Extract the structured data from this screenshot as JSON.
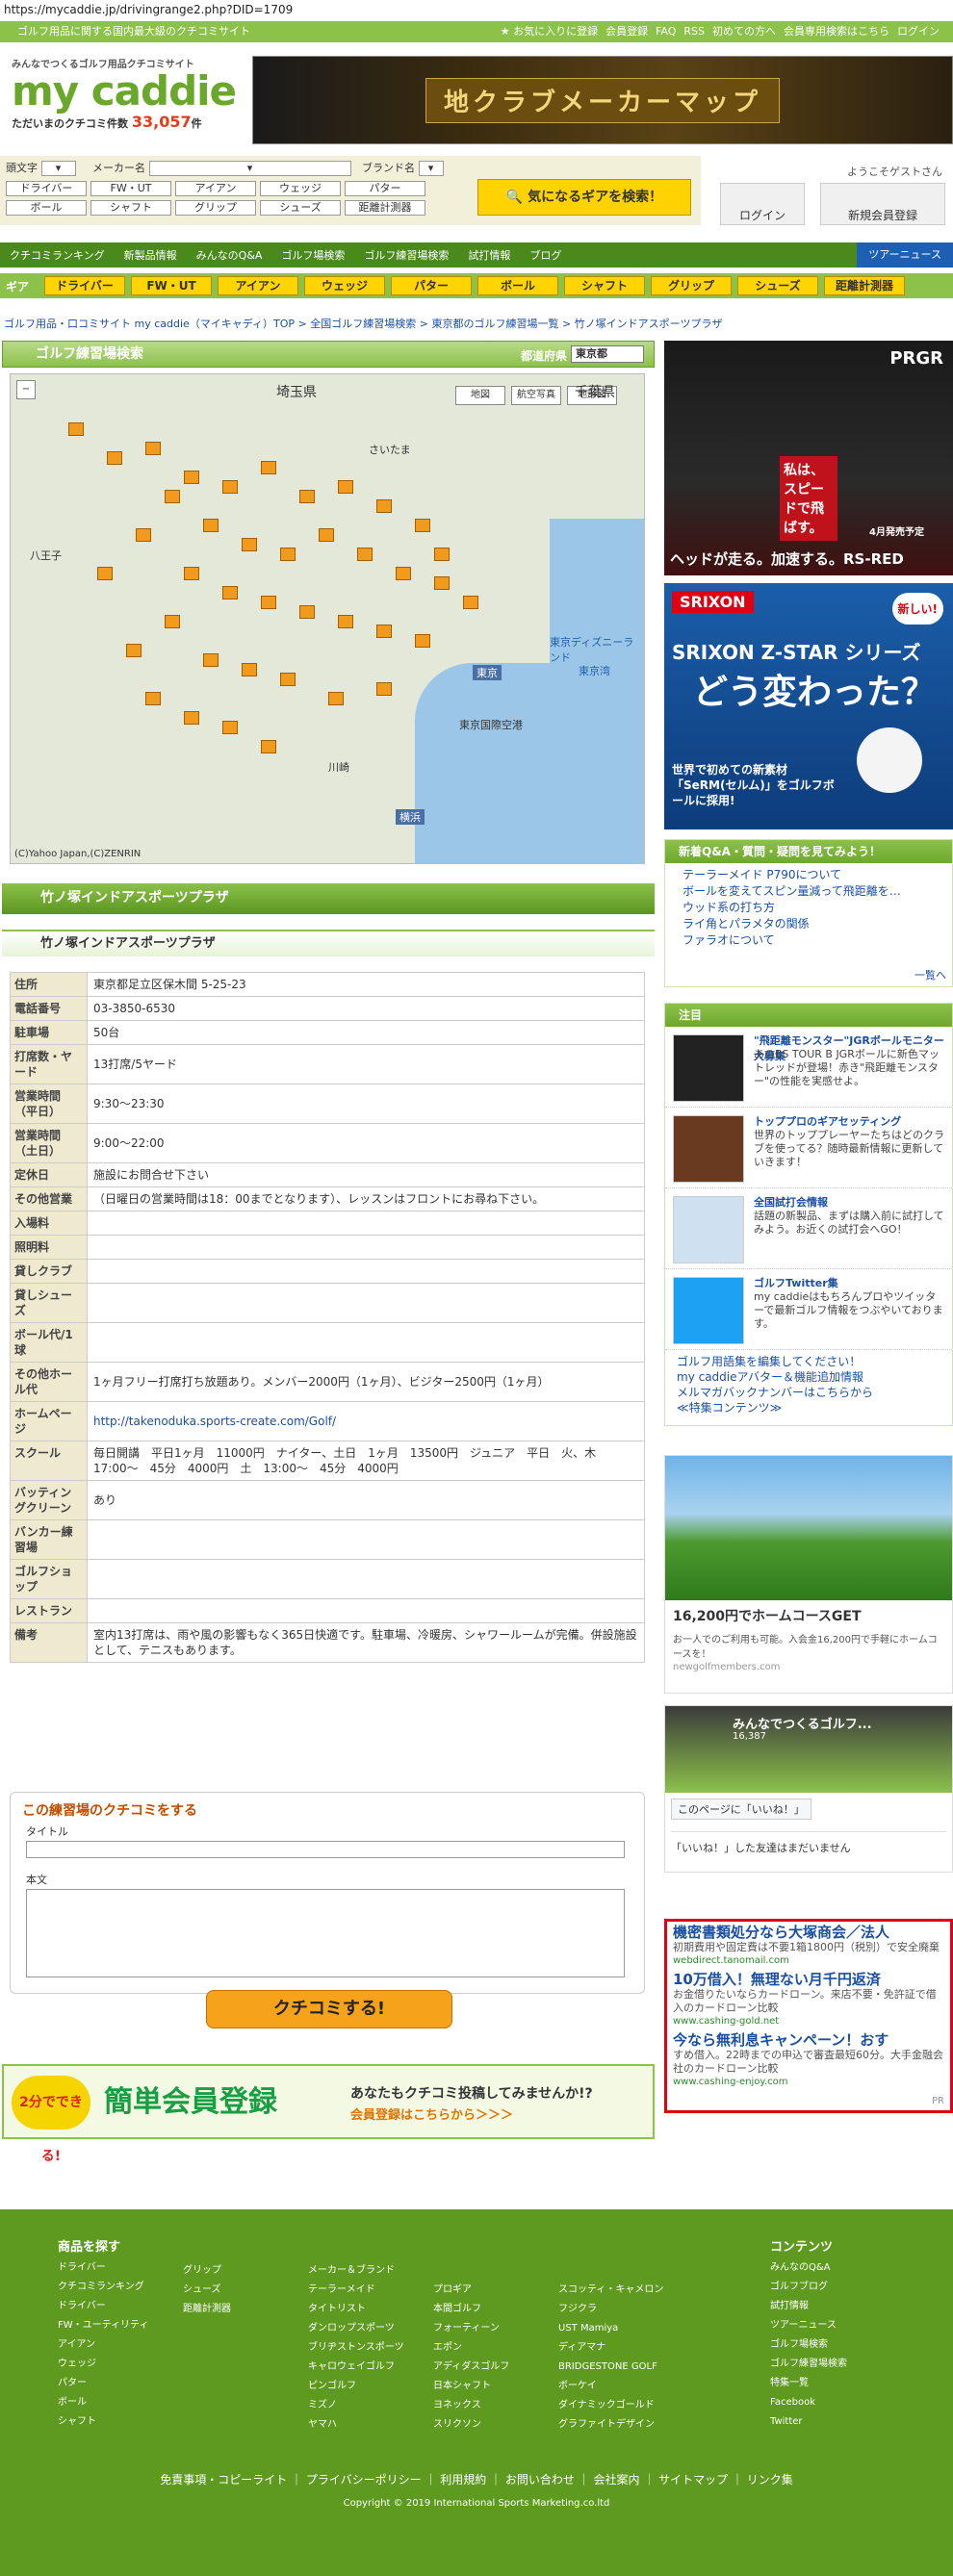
{
  "url": "https://mycaddie.jp/drivingrange2.php?DID=1709",
  "topbar": {
    "tagline": "ゴルフ用品に関する国内最大級のクチコミサイト",
    "links": [
      "お気に入りに登録",
      "会員登録",
      "FAQ",
      "RSS",
      "初めての方へ",
      "会員専用検索はこちら",
      "ログイン"
    ]
  },
  "logo": {
    "sub": "みんなでつくるゴルフ用品クチコミサイト",
    "word": "my caddie",
    "count_label": "ただいまのクチコミ件数",
    "count": "33,057",
    "count_unit": "件"
  },
  "top_banner": "地クラブメーカーマップ",
  "search": {
    "labels": [
      "頭文字",
      "メーカー名",
      "ブランド名"
    ],
    "gear_row1": [
      "ドライバー",
      "FW・UT",
      "アイアン",
      "ウェッジ",
      "パター"
    ],
    "gear_row2": [
      "ボール",
      "シャフト",
      "グリップ",
      "シューズ",
      "距離計測器"
    ],
    "go": "気になるギアを検索！"
  },
  "guest": "ようこそゲストさん",
  "login": "ログイン",
  "register": "新規会員登録",
  "nav": [
    "クチコミランキング",
    "新製品情報",
    "みんなのQ&A",
    "ゴルフ場検索",
    "ゴルフ練習場検索",
    "試打情報",
    "ブログ",
    "ツアーニュース"
  ],
  "gear_tabs": {
    "label": "ギア",
    "items": [
      "ドライバー",
      "FW・UT",
      "アイアン",
      "ウェッジ",
      "パター",
      "ボール",
      "シャフト",
      "グリップ",
      "シューズ",
      "距離計測器"
    ]
  },
  "breadcrumb": "ゴルフ用品・口コミサイト my caddie（マイキャディ）TOP > 全国ゴルフ練習場検索 > 東京都のゴルフ練習場一覧 > 竹ノ塚インドアスポーツプラザ",
  "range_search": {
    "title": "ゴルフ練習場検索",
    "pref_label": "都道府県",
    "pref": "東京都"
  },
  "map": {
    "btns": [
      "地図",
      "航空写真",
      "地形図"
    ],
    "labels": [
      "埼玉県",
      "さいたま",
      "千葉県",
      "東京",
      "横浜",
      "東京国際空港",
      "東京ディズニーランド",
      "東京湾",
      "八王子",
      "川崎"
    ],
    "copy": "(C)Yahoo Japan,(C)ZENRIN"
  },
  "facility": {
    "title": "竹ノ塚インドアスポーツプラザ",
    "sub": "竹ノ塚インドアスポーツプラザ"
  },
  "info": [
    [
      "住所",
      "東京都足立区保木間 5-25-23"
    ],
    [
      "電話番号",
      "03-3850-6530"
    ],
    [
      "駐車場",
      "50台"
    ],
    [
      "打席数・ヤード",
      "13打席/5ヤード"
    ],
    [
      "営業時間（平日）",
      "9:30〜23:30"
    ],
    [
      "営業時間（土日）",
      "9:00〜22:00"
    ],
    [
      "定休日",
      "施設にお問合せ下さい"
    ],
    [
      "その他営業",
      "（日曜日の営業時間は18：00までとなります）、レッスンはフロントにお尋ね下さい。"
    ],
    [
      "入場料",
      ""
    ],
    [
      "照明料",
      ""
    ],
    [
      "貸しクラブ",
      ""
    ],
    [
      "貸しシューズ",
      ""
    ],
    [
      "ボール代/1球",
      ""
    ],
    [
      "その他ホール代",
      "1ヶ月フリー打席打ち放題あり。メンバー2000円（1ヶ月）、ビジター2500円（1ヶ月）"
    ],
    [
      "ホームページ",
      "http://takenoduka.sports-create.com/Golf/"
    ],
    [
      "スクール",
      "毎日開講　平日1ヶ月　11000円　ナイター、土日　1ヶ月　13500円　ジュニア　平日　火、木　17:00〜　45分　4000円　土　13:00〜　45分　4000円"
    ],
    [
      "バッティングクリーン",
      "あり"
    ],
    [
      "バンカー練習場",
      ""
    ],
    [
      "ゴルフショップ",
      ""
    ],
    [
      "レストラン",
      ""
    ],
    [
      "備考",
      "室内13打席は、雨や風の影響もなく365日快適です。駐車場、冷暖房、シャワールームが完備。併設施設として、テニスもあります。"
    ]
  ],
  "review": {
    "title": "この練習場のクチコミをする",
    "title_label": "タイトル",
    "body_label": "本文",
    "submit": "クチコミする!"
  },
  "memreg": {
    "badge": "2分でできる!",
    "big": "簡単会員登録",
    "text": "あなたもクチコミ投稿してみませんか!?",
    "link": "会員登録はこちらから＞＞＞"
  },
  "side": {
    "ad1": {
      "brand": "PRGR",
      "copy": "私は、スピードで飛ばす。",
      "sub": "ヘッドが走る。加速する。RS-RED",
      "date": "4月発売予定"
    },
    "ad2": {
      "brand": "SRIXON",
      "title": "SRIXON Z-STAR シリーズ",
      "big": "どう変わった？",
      "new": "新しい!",
      "foot": "世界で初めての新素材「SeRM(セルム)」をゴルフボールに採用!"
    },
    "qa_head": "新着Q&A・質問・疑問を見てみよう！",
    "qa": [
      "テーラーメイド P790について",
      "ボールを変えてスピン量減って飛距離を…",
      "ウッド系の打ち方",
      "ライ角とパラメタの関係",
      "ファラオについて"
    ],
    "qa_more": "一覧へ",
    "news_head": "注目",
    "news": [
      {
        "t": "\"飛距離モンスター\"JGRボールモニター大募集",
        "d": "あのBS TOUR B JGRボールに新色マットレッドが登場！赤き\"飛距離モンスター\"の性能を実感せよ。"
      },
      {
        "t": "トッププロのギアセッティング",
        "d": "世界のトッププレーヤーたちはどのクラブを使ってる？随時最新情報に更新していきます！"
      },
      {
        "t": "全国試打会情報",
        "d": "話題の新製品、まずは購入前に試打してみよう。お近くの試打会へGO！"
      },
      {
        "t": "ゴルフTwitter集",
        "d": "my caddieはもちろんプロやツイッターで最新ゴルフ情報をつぶやいております。"
      }
    ],
    "links": [
      "ゴルフ用語集を編集してください！",
      "my caddieアバター＆機能追加情報",
      "メルマガバックナンバーはこちらから",
      "≪特集コンテンツ≫"
    ],
    "gad": {
      "title": "16,200円でホームコースGET",
      "desc": "お一人でのご利用も可能。入会金16,200円で手軽にホームコースを！",
      "url": "newgolfmembers.com"
    },
    "fb": {
      "name": "みんなでつくるゴルフ...",
      "likes": "16,387",
      "like_btn": "このページに「いいね！」",
      "none": "「いいね！」した友達はまだいません"
    },
    "textad": [
      {
        "h": "機密書類処分なら大塚商会／法人",
        "d": "初期費用や固定費は不要1箱1800円（税別）で安全廃棄",
        "u": "webdirect.tanomail.com"
      },
      {
        "h": "10万借入！無理ない月千円返済",
        "d": "お金借りたいならカードローン。来店不要・免許証で借入のカードローン比較",
        "u": "www.cashing-gold.net"
      },
      {
        "h": "今なら無利息キャンペーン！おす",
        "d": "すめ借入。22時までの申込で審査最短60分。大手金融会社のカードローン比較",
        "u": "www.cashing-enjoy.com"
      }
    ],
    "textad_pr": "PR"
  },
  "footer": {
    "col1_head": "商品を探す",
    "col1": [
      "ドライバー",
      "クチコミランキング",
      "ドライバー",
      "FW・ユーティリティ",
      "アイアン",
      "ウェッジ",
      "パター",
      "ボール",
      "シャフト"
    ],
    "col1b": [
      "グリップ",
      "シューズ",
      "距離計測器"
    ],
    "col2_head": "メーカー＆ブランド",
    "col2": [
      "テーラーメイド",
      "タイトリスト",
      "ダンロップスポーツ",
      "ブリヂストンスポーツ",
      "キャロウェイゴルフ",
      "ピンゴルフ",
      "ミズノ",
      "ヤマハ"
    ],
    "col3": [
      "プロギア",
      "本間ゴルフ",
      "フォーティーン",
      "エポン",
      "アディダスゴルフ",
      "日本シャフト",
      "ヨネックス",
      "スリクソン"
    ],
    "col4": [
      "スコッティ・キャメロン",
      "フジクラ",
      "UST Mamiya",
      "ディアマナ",
      "BRIDGESTONE GOLF",
      "ボーケイ",
      "ダイナミックゴールド",
      "グラファイトデザイン"
    ],
    "col5_head": "コンテンツ",
    "col5": [
      "みんなのQ&A",
      "ゴルフブログ",
      "試打情報",
      "ツアーニュース",
      "ゴルフ場検索",
      "ゴルフ練習場検索",
      "特集一覧",
      "Facebook",
      "Twitter"
    ],
    "bottom": "免責事項・コピーライト ｜ プライバシーポリシー ｜ 利用規約 ｜ お問い合わせ ｜ 会社案内 ｜ サイトマップ ｜ リンク集",
    "copy": "Copyright © 2019 International Sports Marketing.co.ltd"
  },
  "colors": {
    "brand_green": "#8cc14a",
    "dark_green": "#5e9a1f",
    "accent_yellow": "#ffd400",
    "alert_red": "#e00012"
  }
}
